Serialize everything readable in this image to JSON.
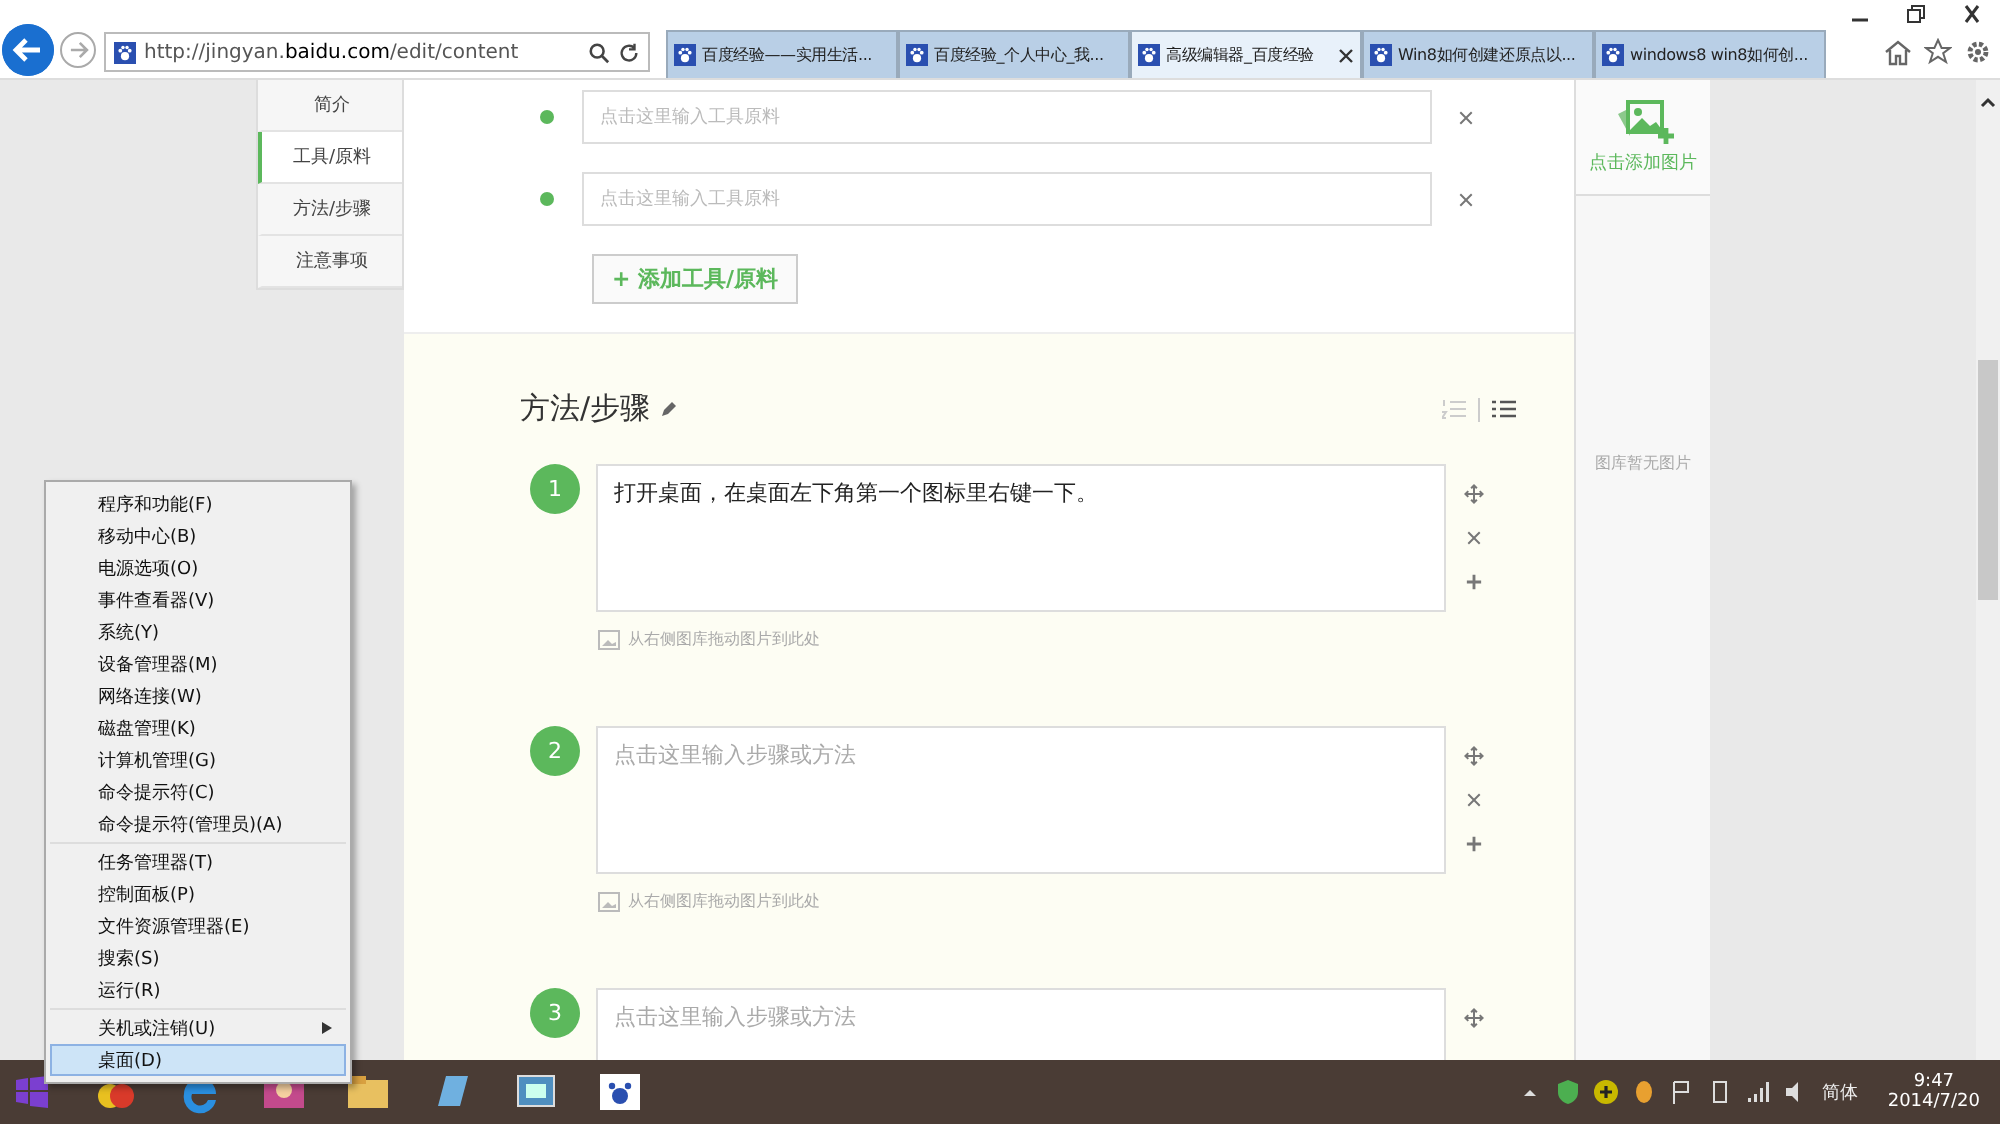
{
  "browser": {
    "address": "http://jingyan.**baidu.com**/edit/content",
    "tabs": [
      {
        "title": "百度经验——实用生活...",
        "selected": false
      },
      {
        "title": "百度经验_个人中心_我...",
        "selected": false
      },
      {
        "title": "高级编辑器_百度经验",
        "selected": true
      },
      {
        "title": "Win8如何创建还原点以...",
        "selected": false
      },
      {
        "title": "windows8 win8如何创...",
        "selected": false
      }
    ]
  },
  "nav": [
    {
      "label": "简介",
      "selected": false
    },
    {
      "label": "工具/原料",
      "selected": true
    },
    {
      "label": "方法/步骤",
      "selected": false
    },
    {
      "label": "注意事项",
      "selected": false
    }
  ],
  "tools": {
    "items": [
      {
        "placeholder": "点击这里输入工具原料"
      },
      {
        "placeholder": "点击这里输入工具原料"
      }
    ],
    "add_button": "+ 添加工具/原料"
  },
  "steps_section": {
    "title": "方法/步骤",
    "view_modes": [
      {
        "kind": "numbered",
        "selected": false
      },
      {
        "kind": "bulleted",
        "selected": true
      }
    ],
    "steps": [
      {
        "number": "1",
        "value": "打开桌面，在桌面左下角第一个图标里右键一下。",
        "hint": "从右侧图库拖动图片到此处",
        "controls": [
          {
            "kind": "move"
          },
          {
            "kind": "delete"
          },
          {
            "kind": "add"
          }
        ]
      },
      {
        "number": "2",
        "placeholder": "点击这里输入步骤或方法",
        "hint": "从右侧图库拖动图片到此处",
        "controls": [
          {
            "kind": "move"
          },
          {
            "kind": "delete"
          },
          {
            "kind": "add"
          }
        ]
      },
      {
        "number": "3",
        "placeholder": "点击这里输入步骤或方法",
        "controls": [
          {
            "kind": "move"
          }
        ]
      }
    ]
  },
  "gallery": {
    "add_label": "点击添加图片",
    "empty_text": "图库暂无图片"
  },
  "context_menu": {
    "groups": [
      [
        {
          "label": "程序和功能(F)",
          "has_submenu": false,
          "selected": false
        },
        {
          "label": "移动中心(B)",
          "has_submenu": false,
          "selected": false
        },
        {
          "label": "电源选项(O)",
          "has_submenu": false,
          "selected": false
        },
        {
          "label": "事件查看器(V)",
          "has_submenu": false,
          "selected": false
        },
        {
          "label": "系统(Y)",
          "has_submenu": false,
          "selected": false
        },
        {
          "label": "设备管理器(M)",
          "has_submenu": false,
          "selected": false
        },
        {
          "label": "网络连接(W)",
          "has_submenu": false,
          "selected": false
        },
        {
          "label": "磁盘管理(K)",
          "has_submenu": false,
          "selected": false
        },
        {
          "label": "计算机管理(G)",
          "has_submenu": false,
          "selected": false
        },
        {
          "label": "命令提示符(C)",
          "has_submenu": false,
          "selected": false
        },
        {
          "label": "命令提示符(管理员)(A)",
          "has_submenu": false,
          "selected": false
        }
      ],
      [
        {
          "label": "任务管理器(T)",
          "has_submenu": false,
          "selected": false
        },
        {
          "label": "控制面板(P)",
          "has_submenu": false,
          "selected": false
        },
        {
          "label": "文件资源管理器(E)",
          "has_submenu": false,
          "selected": false
        },
        {
          "label": "搜索(S)",
          "has_submenu": false,
          "selected": false
        },
        {
          "label": "运行(R)",
          "has_submenu": false,
          "selected": false
        }
      ],
      [
        {
          "label": "关机或注销(U)",
          "has_submenu": true,
          "selected": false
        },
        {
          "label": "桌面(D)",
          "has_submenu": false,
          "selected": true
        }
      ]
    ]
  },
  "taskbar": {
    "ime": "简体",
    "time": "9:47",
    "date": "2014/7/20"
  }
}
